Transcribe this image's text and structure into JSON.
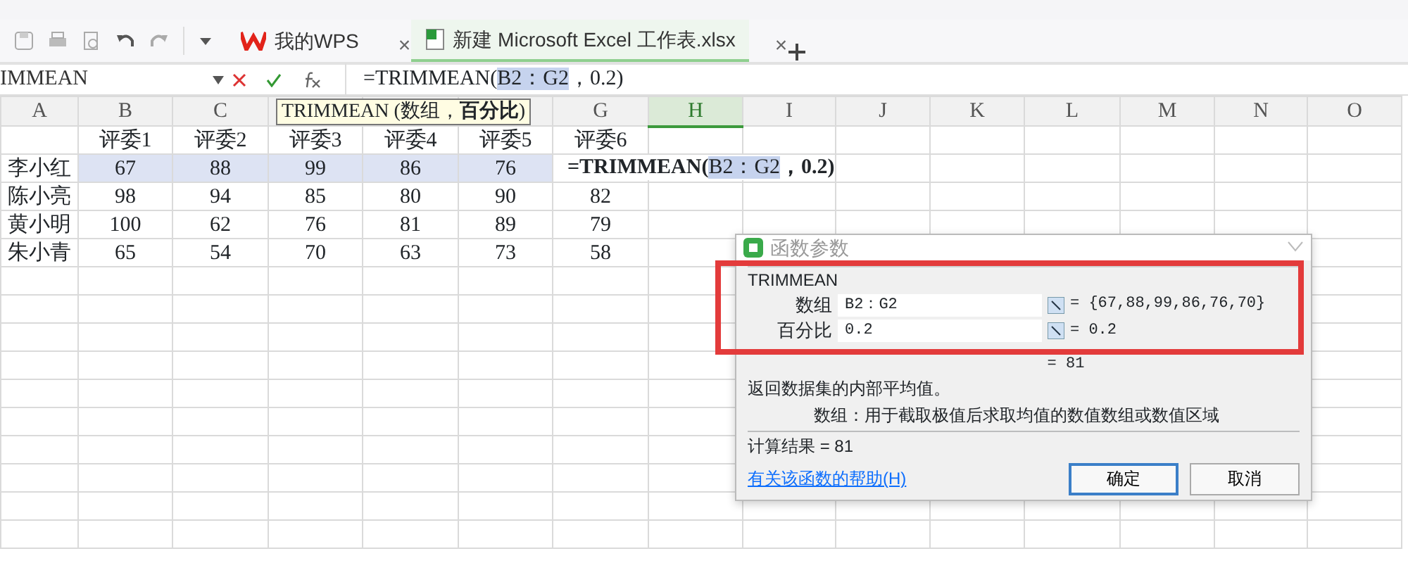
{
  "toolbar": {
    "tabs": [
      {
        "label": "我的WPS",
        "selected": false,
        "kind": "home",
        "close": "×"
      },
      {
        "label": "新建 Microsoft Excel 工作表.xlsx",
        "selected": true,
        "kind": "sheet",
        "close": "×"
      }
    ]
  },
  "formula_bar": {
    "name_box": "IMMEAN",
    "prefix": "=TRIMMEAN(",
    "ref": "B2：G2",
    "suffix": "，0.2)"
  },
  "tooltip": "TRIMMEAN (数组，**百分比**)",
  "columns": [
    {
      "label": "A",
      "selected": false
    },
    {
      "label": "B",
      "selected": false
    },
    {
      "label": "C",
      "selected": false
    },
    {
      "selected": false
    },
    {
      "selected": false
    },
    {
      "selected": false
    },
    {
      "label": "G",
      "selected": false
    },
    {
      "label": "H",
      "selected": true
    },
    {
      "label": "I",
      "selected": false
    },
    {
      "label": "J",
      "selected": false
    },
    {
      "label": "K",
      "selected": false
    },
    {
      "label": "L",
      "selected": false
    },
    {
      "label": "M",
      "selected": false
    },
    {
      "label": "N",
      "selected": false
    },
    {
      "label": "O",
      "selected": false
    }
  ],
  "rows": [
    {
      "cells": [
        "",
        "评委1",
        "评委2",
        "评委3",
        "评委4",
        "评委5",
        "评委6"
      ],
      "in_range": false
    },
    {
      "cells": [
        "李小红",
        "67",
        "88",
        "99",
        "86",
        "76"
      ],
      "in_range": true,
      "edit": {
        "prefix": "=TRIMMEAN(",
        "ref": "B2：G2",
        "suffix": "，0.2)"
      }
    },
    {
      "cells": [
        "陈小亮",
        "98",
        "94",
        "85",
        "80",
        "90",
        "82"
      ],
      "in_range": false
    },
    {
      "cells": [
        "黄小明",
        "100",
        "62",
        "76",
        "81",
        "89",
        "79"
      ],
      "in_range": false
    },
    {
      "cells": [
        "朱小青",
        "65",
        "54",
        "70",
        "63",
        "73",
        "58"
      ],
      "in_range": false
    }
  ],
  "dialog": {
    "title": "函数参数",
    "group": "TRIMMEAN",
    "args": [
      {
        "label": "数组",
        "value": "B2：G2",
        "result": "= {67,88,99,86,76,70}"
      },
      {
        "label": "百分比",
        "value": "0.2",
        "result": "= 0.2"
      }
    ],
    "result": "= 81",
    "description": "返回数据集的内部平均值。",
    "arg_help": "数组：用于截取极值后求取均值的数值数组或数值区域",
    "calc": "计算结果 = 81",
    "help_link": "有关该函数的帮助(H)",
    "buttons": [
      {
        "label": "确定",
        "default": true
      },
      {
        "label": "取消",
        "default": false
      }
    ]
  }
}
